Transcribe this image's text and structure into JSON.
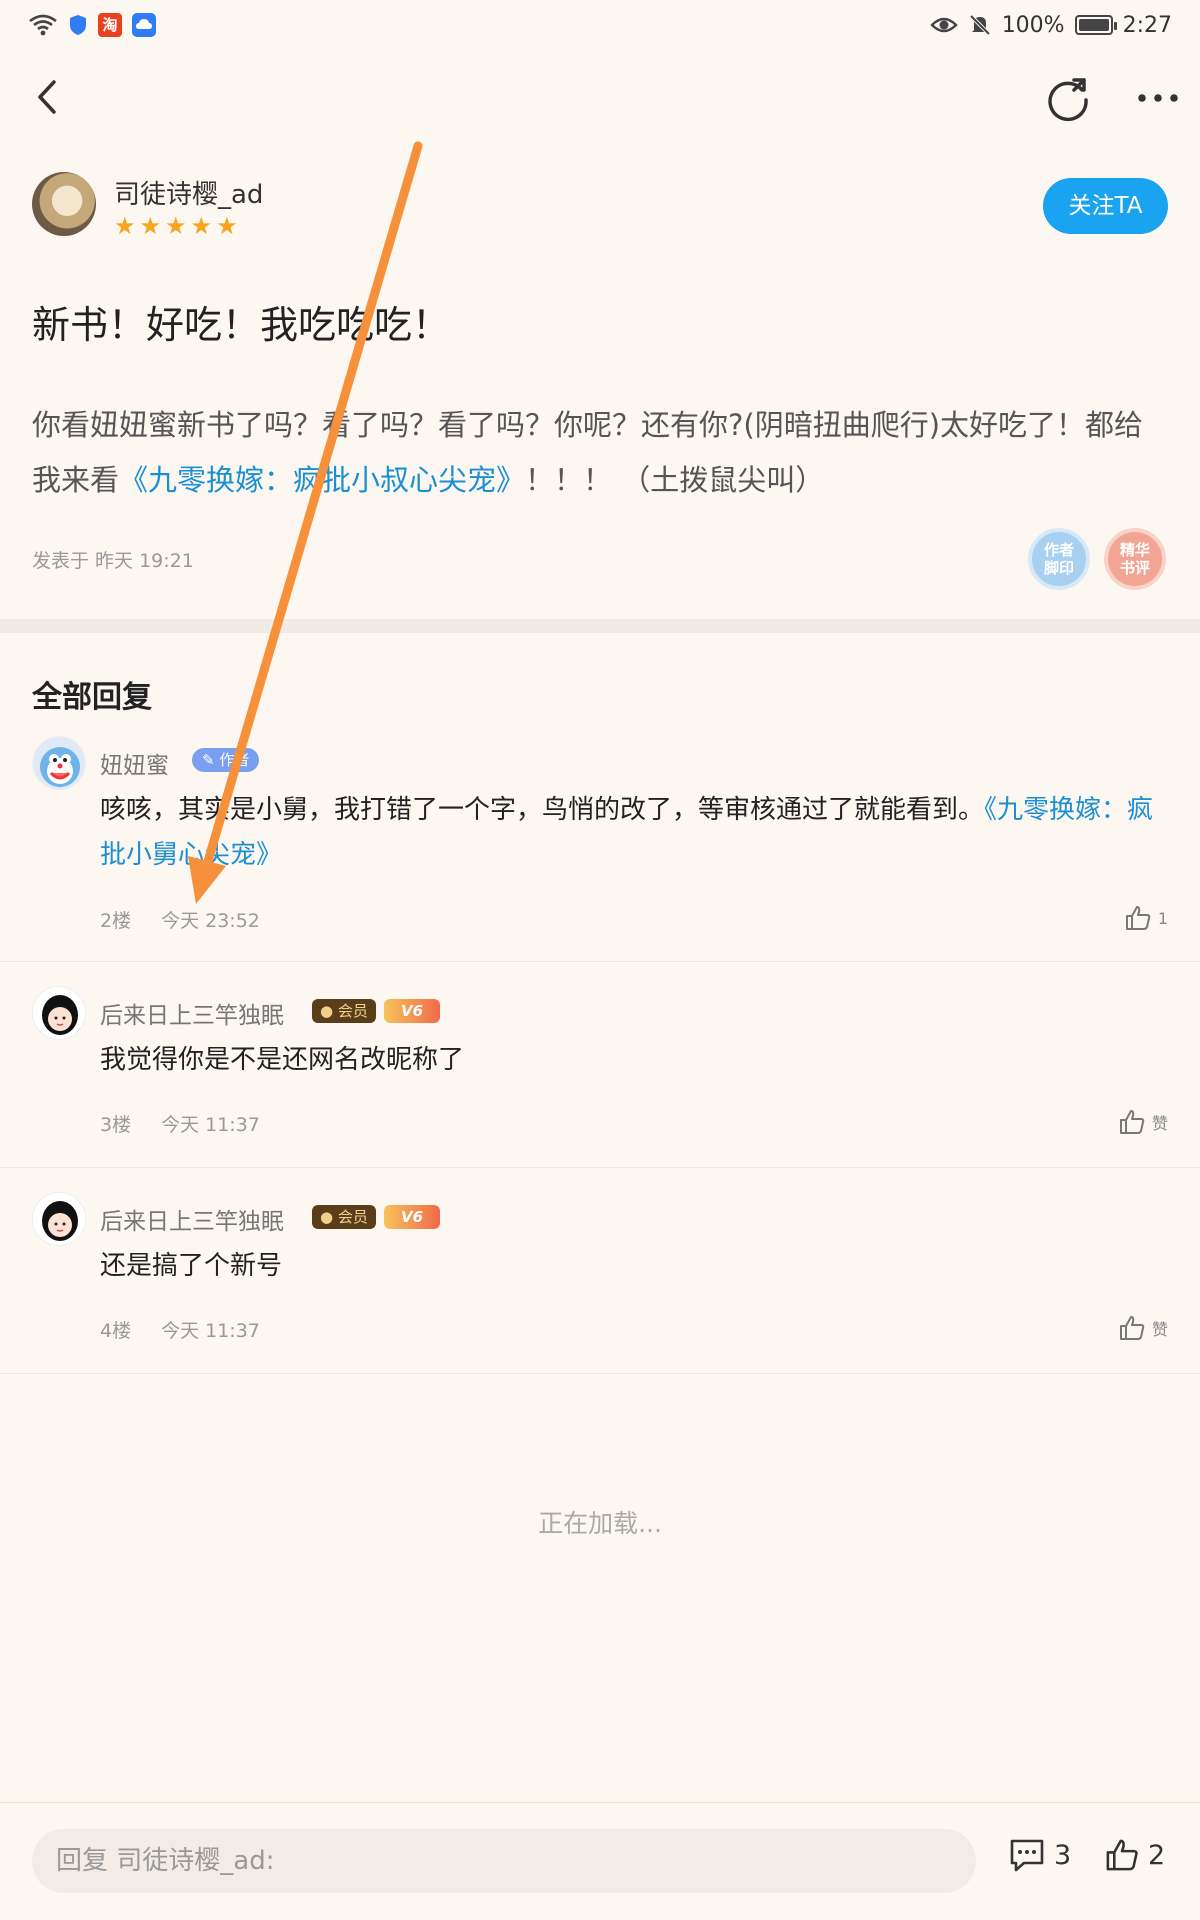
{
  "status_bar": {
    "taobao_label": "淘",
    "battery": "100%",
    "time": "2:27"
  },
  "post": {
    "author_name": "司徒诗樱_ad",
    "author_rating_stars": 5,
    "follow_label": "关注TA",
    "title": "新书！好吃！我吃吃吃！",
    "body_prefix": "你看妞妞蜜新书了吗？看了吗？看了吗？你呢？还有你?(阴暗扭曲爬行)太好吃了！都给我来看",
    "body_link": "《九零换嫁：疯批小叔心尖宠》",
    "body_suffix": "！！！ （土拨鼠尖叫）",
    "meta": "发表于 昨天 19:21",
    "badge_author_footprint": "作者\n脚印",
    "badge_essence": "精华\n书评"
  },
  "replies_heading": "全部回复",
  "replies": [
    {
      "name": "妞妞蜜",
      "tag": "作者",
      "text_prefix": "咳咳，其实是小舅，我打错了一个字，鸟悄的改了，等审核通过了就能看到。",
      "text_link": "《九零换嫁：疯批小舅心尖宠》",
      "floor": "2楼",
      "time": "今天 23:52",
      "likes": "1"
    },
    {
      "name": "后来日上三竿独眠",
      "member_tag": "会员",
      "vip_tag": "V6",
      "text": "我觉得你是不是还网名改昵称了",
      "floor": "3楼",
      "time": "今天 11:37",
      "likes": "赞"
    },
    {
      "name": "后来日上三竿独眠",
      "member_tag": "会员",
      "vip_tag": "V6",
      "text": "还是搞了个新号",
      "floor": "4楼",
      "time": "今天 11:37",
      "likes": "赞"
    }
  ],
  "loading_text": "正在加载...",
  "bottom_bar": {
    "reply_placeholder": "回复 司徒诗樱_ad:",
    "comment_count": "3",
    "like_count": "2"
  },
  "colors": {
    "accent_blue": "#1aa3f0",
    "link_blue": "#1a8fd4",
    "star_orange": "#f7a51c",
    "annotation_arrow": "#f7903a"
  }
}
